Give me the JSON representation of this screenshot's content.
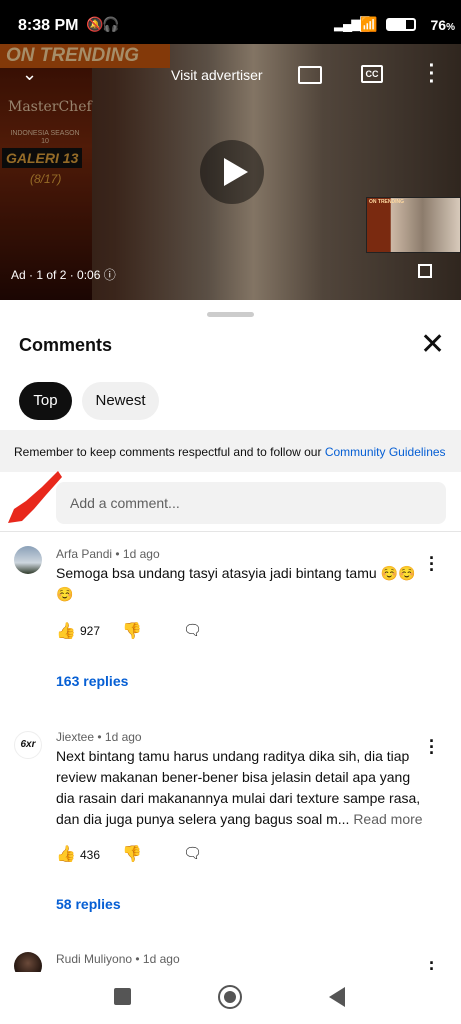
{
  "status_bar": {
    "time": "8:38 PM",
    "battery": "76"
  },
  "video": {
    "trending_banner": "ON TRENDING",
    "poster_title": "MasterChef",
    "poster_subtitle": "INDONESIA SEASON 10",
    "poster_gallery": "GALERI 13",
    "poster_count": "(8/17)",
    "visit_advertiser": "Visit advertiser",
    "cc_label": "CC",
    "ad_info": "Ad · 1 of 2 · 0:06"
  },
  "sheet": {
    "title": "Comments",
    "tabs": [
      {
        "label": "Top",
        "selected": true
      },
      {
        "label": "Newest",
        "selected": false
      }
    ],
    "notice": "Remember to keep comments respectful and to follow our",
    "notice_link": "Community Guidelines",
    "add_placeholder": "Add a comment..."
  },
  "comments": [
    {
      "author": "Arfa Pandi",
      "time": "1d ago",
      "text": "Semoga bsa undang tasyi atasyia jadi bintang tamu ☺️☺️☺️",
      "likes": "927",
      "replies": "163 replies"
    },
    {
      "author": "Jiextee",
      "time": "1d ago",
      "avatar_text": "6xr",
      "text": "Next bintang tamu harus undang raditya dika sih, dia tiap review makanan bener-bener bisa jelasin detail apa yang dia rasain dari makanannya mulai dari texture sampe rasa, dan dia juga punya selera yang bagus soal m...",
      "read_more": "Read more",
      "likes": "436",
      "replies": "58 replies"
    },
    {
      "author": "Rudi Muliyono",
      "time": "1d ago"
    }
  ],
  "colors": {
    "accent_link": "#065fd4",
    "chip_selected": "#0f0f0f",
    "notice_bg": "#f2f2f2"
  }
}
